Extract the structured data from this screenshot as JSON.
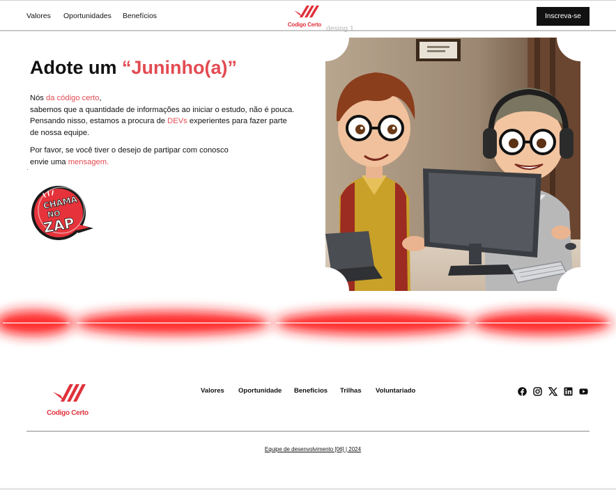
{
  "header": {
    "nav": [
      "Valores",
      "Oportunidades",
      "Benefícios"
    ],
    "logo_text": "Codigo Certo",
    "artboard_label": "desing 1",
    "cta_label": "Inscreva-se"
  },
  "hero": {
    "title_prefix": "Adote um",
    "title_accent": "“Juninho(a)”",
    "p1": {
      "a": "Nós ",
      "b": "da código certo",
      "c": ",",
      "line2": "sabemos que a quantidade de informações ao iniciar o estudo, não é pouca.",
      "line3a": "Pensando nisso, estamos a procura de ",
      "line3b": "DEVs",
      "line3c": " experientes para fazer parte",
      "line4": "de nossa equipe."
    },
    "p2": {
      "line1": "Por favor, se você tiver o desejo de partipar com conosco",
      "line2a": "envie uma ",
      "line2b": "mensagem."
    },
    "whatsapp_badge_text": "CHAMA NO ZAP"
  },
  "footer": {
    "logo_text": "Codigo Certo",
    "nav": [
      "Valores",
      "Oportunidade",
      "Beneficios",
      "Trilhas",
      "Voluntariado"
    ],
    "social_icons": [
      "facebook-icon",
      "instagram-icon",
      "x-icon",
      "linkedin-icon",
      "youtube-icon"
    ],
    "copyright": "Equipe de desenvolvimento [06] | 2024"
  },
  "colors": {
    "accent": "#e34b52",
    "brand_red": "#e0313b",
    "dark": "#111111"
  }
}
